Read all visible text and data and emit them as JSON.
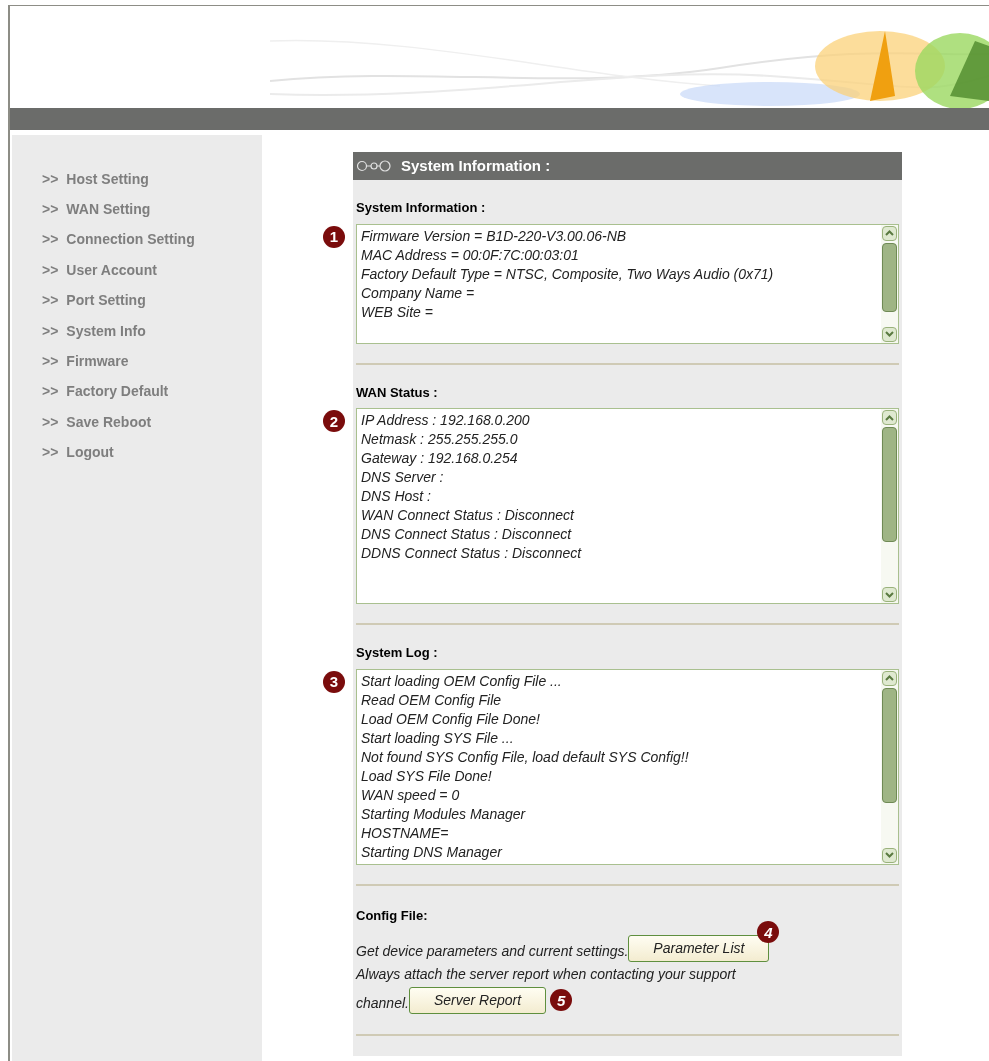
{
  "sidebar": {
    "items": [
      {
        "prefix": ">>",
        "label": "Host Setting"
      },
      {
        "prefix": ">>",
        "label": "WAN Setting"
      },
      {
        "prefix": ">>",
        "label": "Connection Setting"
      },
      {
        "prefix": ">>",
        "label": "User Account"
      },
      {
        "prefix": ">>",
        "label": "Port Setting"
      },
      {
        "prefix": ">>",
        "label": "System Info"
      },
      {
        "prefix": ">>",
        "label": "Firmware"
      },
      {
        "prefix": ">>",
        "label": "Factory Default"
      },
      {
        "prefix": ">>",
        "label": "Save Reboot"
      },
      {
        "prefix": ">>",
        "label": "Logout"
      }
    ]
  },
  "panel": {
    "title": "System Information :",
    "sections": [
      {
        "label": "System Information :",
        "marker": "1",
        "lines": [
          "Firmware Version = B1D-220-V3.00.06-NB",
          "MAC Address = 00:0F:7C:00:03:01",
          "Factory Default Type = NTSC, Composite, Two Ways Audio (0x71)",
          "Company Name =",
          "WEB Site ="
        ]
      },
      {
        "label": "WAN Status :",
        "marker": "2",
        "lines": [
          "IP Address : 192.168.0.200",
          "Netmask : 255.255.255.0",
          "Gateway : 192.168.0.254",
          "DNS Server :",
          "DNS Host :",
          "WAN Connect Status : Disconnect",
          "DNS Connect Status : Disconnect",
          "DDNS Connect Status : Disconnect"
        ]
      },
      {
        "label": "System Log :",
        "marker": "3",
        "lines": [
          "Start loading OEM Config File ...",
          "Read OEM Config File",
          "Load OEM Config File Done!",
          "Start loading SYS File ...",
          "Not found SYS Config File, load default SYS Config!!",
          "Load SYS File Done!",
          "WAN speed = 0",
          "Starting Modules Manager",
          "HOSTNAME=",
          "Starting DNS Manager"
        ]
      }
    ],
    "config": {
      "label": "Config File:",
      "text_1": "Get device parameters and current settings.",
      "button_1": "Parameter List",
      "marker_1": "4",
      "text_2": "Always attach the server report when contacting your support",
      "text_3": "channel.",
      "button_2": "Server Report",
      "marker_2": "5"
    }
  }
}
